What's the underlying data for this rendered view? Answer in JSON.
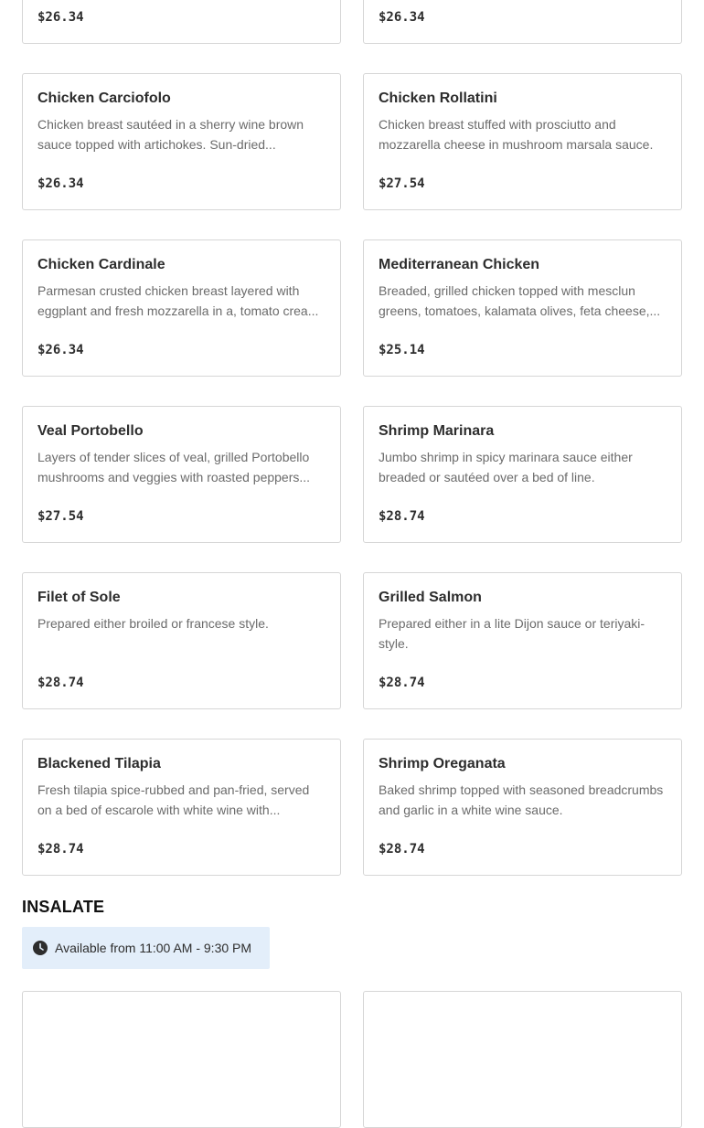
{
  "top_partial": {
    "left_price": "$26.34",
    "right_price": "$26.34"
  },
  "items": [
    {
      "name": "Chicken Carciofolo",
      "description": "Chicken breast sautéed in a sherry wine brown sauce topped with artichokes. Sun-dried...",
      "price": "$26.34"
    },
    {
      "name": "Chicken Rollatini",
      "description": "Chicken breast stuffed with prosciutto and mozzarella cheese in mushroom marsala sauce.",
      "price": "$27.54"
    },
    {
      "name": "Chicken Cardinale",
      "description": "Parmesan crusted chicken breast layered with eggplant and fresh mozzarella in a, tomato crea...",
      "price": "$26.34"
    },
    {
      "name": "Mediterranean Chicken",
      "description": "Breaded, grilled chicken topped with mesclun greens, tomatoes, kalamata olives, feta cheese,...",
      "price": "$25.14"
    },
    {
      "name": "Veal Portobello",
      "description": "Layers of tender slices of veal, grilled Portobello mushrooms and veggies with roasted peppers...",
      "price": "$27.54"
    },
    {
      "name": "Shrimp Marinara",
      "description": "Jumbo shrimp in spicy marinara sauce either breaded or sautéed over a bed of line.",
      "price": "$28.74"
    },
    {
      "name": "Filet of Sole",
      "description": "Prepared either broiled or francese style.",
      "price": "$28.74"
    },
    {
      "name": "Grilled Salmon",
      "description": "Prepared either in a lite Dijon sauce or teriyaki-style.",
      "price": "$28.74"
    },
    {
      "name": "Blackened Tilapia",
      "description": "Fresh tilapia spice-rubbed and pan-fried, served on a bed of escarole with white wine with...",
      "price": "$28.74"
    },
    {
      "name": "Shrimp Oreganata",
      "description": "Baked shrimp topped with seasoned breadcrumbs and garlic in a white wine sauce.",
      "price": "$28.74"
    }
  ],
  "section": {
    "title": "INSALATE",
    "hours": "Available from 11:00 AM - 9:30 PM",
    "hours_icon": "clock-icon"
  },
  "colors": {
    "card_border": "#d6d6d6",
    "description": "#6b6b6b",
    "hours_badge_bg": "#e3eefa"
  }
}
